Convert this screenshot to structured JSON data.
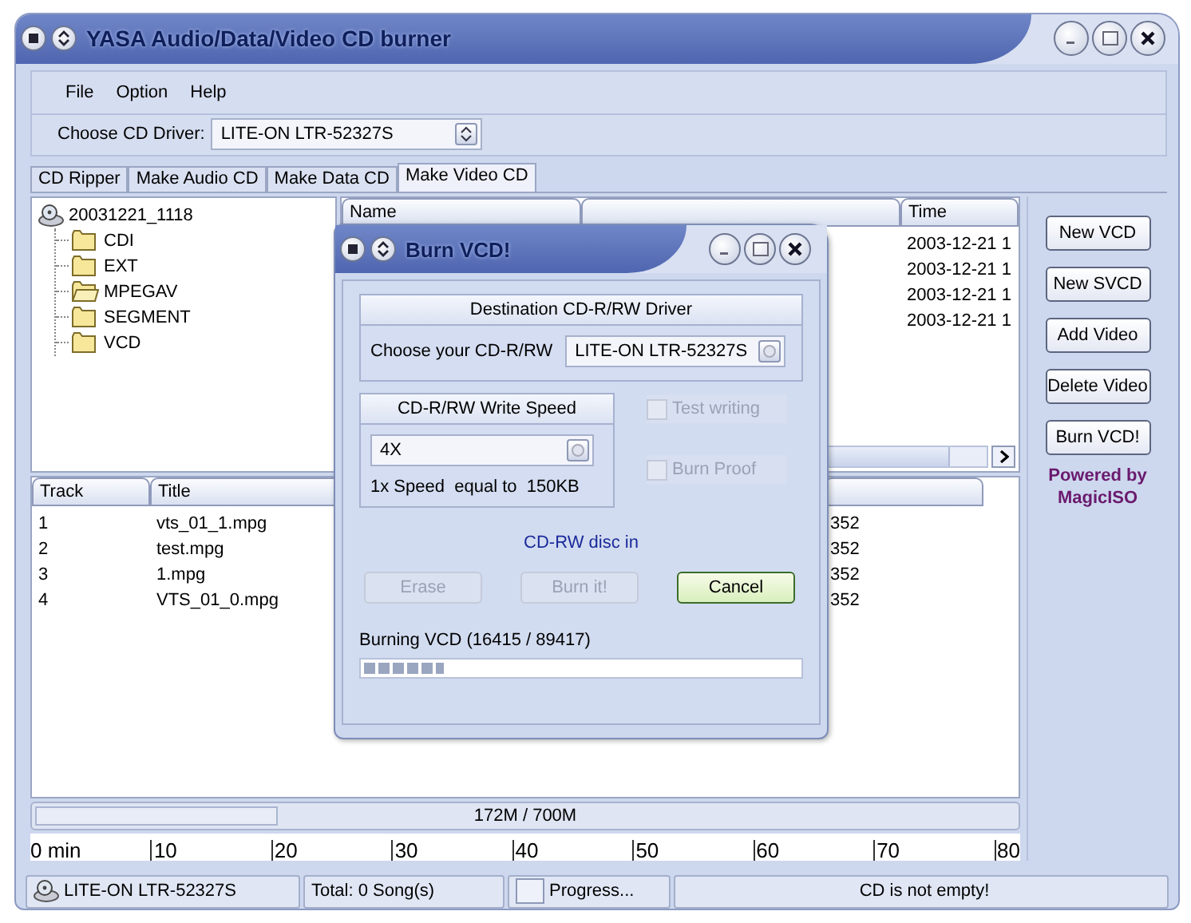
{
  "window": {
    "title": "YASA Audio/Data/Video CD burner"
  },
  "menu": [
    "File",
    "Option",
    "Help"
  ],
  "driver": {
    "label": "Choose CD Driver:",
    "value": "LITE-ON LTR-52327S"
  },
  "tabs": [
    {
      "label": "CD Ripper",
      "selected": false
    },
    {
      "label": "Make Audio CD",
      "selected": false
    },
    {
      "label": "Make Data CD",
      "selected": false
    },
    {
      "label": "Make Video CD",
      "selected": true
    }
  ],
  "tree": {
    "label": "20031221_1118",
    "children": [
      {
        "label": "CDI",
        "open": false
      },
      {
        "label": "EXT",
        "open": false
      },
      {
        "label": "MPEGAV",
        "open": true
      },
      {
        "label": "SEGMENT",
        "open": false
      },
      {
        "label": "VCD",
        "open": false
      }
    ]
  },
  "file_list": {
    "name_column": "Name",
    "time_column": "Time",
    "rows": [
      {
        "time": "2003-12-21 1"
      },
      {
        "time": "2003-12-21 1"
      },
      {
        "time": "2003-12-21 1"
      },
      {
        "time": "2003-12-21 1"
      }
    ]
  },
  "track_list": {
    "track_column": "Track",
    "title_column": "Title",
    "rows": [
      {
        "track": "1",
        "title": "vts_01_1.mpg",
        "column_4": "352"
      },
      {
        "track": "2",
        "title": "test.mpg",
        "column_4": "352"
      },
      {
        "track": "3",
        "title": "1.mpg",
        "column_4": "352"
      },
      {
        "track": "4",
        "title": "VTS_01_0.mpg",
        "column_4": "352"
      }
    ]
  },
  "capacity": {
    "reading": "172M / 700M",
    "level": 0.246
  },
  "ruler": [
    "0 min",
    "10",
    "20",
    "30",
    "40",
    "50",
    "60",
    "70",
    "80"
  ],
  "side_buttons": [
    "New VCD",
    "New SVCD",
    "Add Video",
    "Delete Video",
    "Burn VCD!"
  ],
  "powered_by": "Powered by MagicISO",
  "status_bar": {
    "drive": "LITE-ON LTR-52327S",
    "total": "Total: 0 Song(s)",
    "progress": {
      "label": "Progress...",
      "level": 0
    },
    "message": "CD is not empty!"
  },
  "dialog": {
    "title": "Burn VCD!",
    "destination": {
      "heading": "Destination CD-R/RW Driver",
      "label": "Choose your CD-R/RW",
      "value": "LITE-ON LTR-52327S"
    },
    "speed": {
      "heading": "CD-R/RW Write Speed",
      "value": "4X",
      "note": "1x Speed  equal to  150KB"
    },
    "options": [
      {
        "label": "Test writing",
        "checked": false,
        "disabled": true
      },
      {
        "label": "Burn Proof",
        "checked": false,
        "disabled": true
      }
    ],
    "disc_status": "CD-RW disc in",
    "buttons": [
      {
        "label": "Erase",
        "disabled": true,
        "default": false
      },
      {
        "label": "Burn it!",
        "disabled": true,
        "default": false
      },
      {
        "label": "Cancel",
        "disabled": false,
        "default": true
      }
    ],
    "progress_label": "Burning VCD (16415 / 89417)",
    "progress": {
      "level": 0.184
    }
  }
}
